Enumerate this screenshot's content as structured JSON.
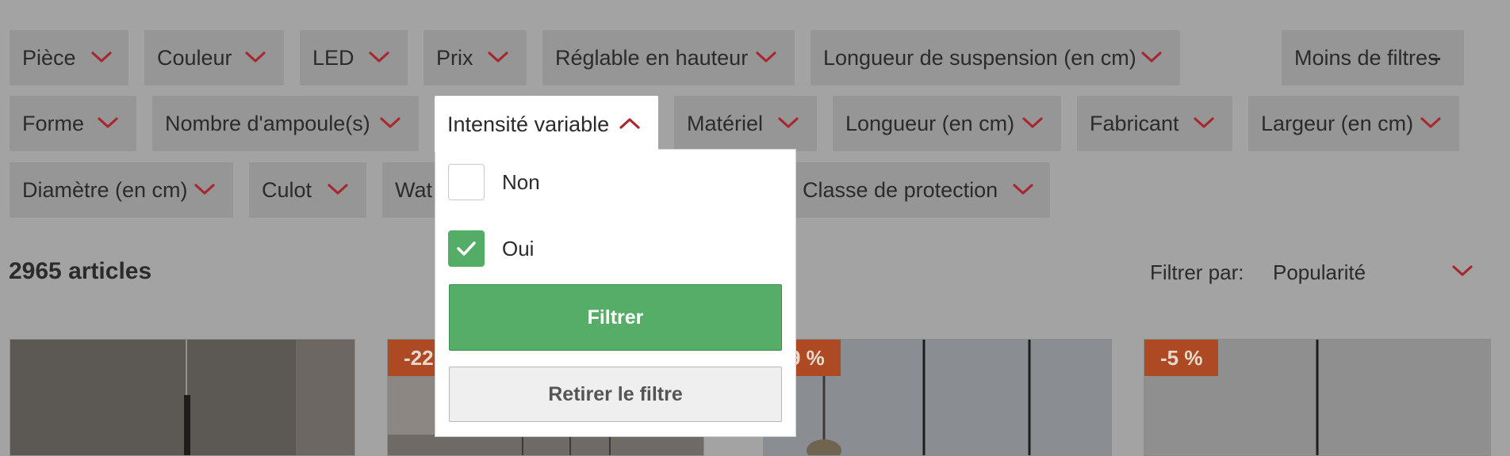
{
  "filters": {
    "row1": [
      {
        "label": "Pièce"
      },
      {
        "label": "Couleur"
      },
      {
        "label": "LED"
      },
      {
        "label": "Prix"
      },
      {
        "label": "Réglable en hauteur"
      },
      {
        "label": "Longueur de suspension (en cm)"
      }
    ],
    "less_filters": "Moins de filtres",
    "row2": [
      {
        "label": "Forme"
      },
      {
        "label": "Nombre d'ampoule(s)"
      },
      {
        "label": "Intensité variable"
      },
      {
        "label": "Matériel"
      },
      {
        "label": "Longueur (en cm)"
      },
      {
        "label": "Fabricant"
      },
      {
        "label": "Largeur (en cm)"
      }
    ],
    "row3": [
      {
        "label": "Diamètre (en cm)"
      },
      {
        "label": "Culot"
      },
      {
        "label": "Wat"
      },
      {
        "label": "Classe de protection"
      }
    ]
  },
  "dropdown": {
    "options": [
      {
        "label": "Non",
        "checked": false
      },
      {
        "label": "Oui",
        "checked": true
      }
    ],
    "apply_label": "Filtrer",
    "remove_label": "Retirer le filtre"
  },
  "results": {
    "count": "2965 articles",
    "sort_label": "Filtrer par:",
    "sort_value": "Popularité"
  },
  "products": [
    {
      "badge": ""
    },
    {
      "badge": "-22"
    },
    {
      "badge": "9 %"
    },
    {
      "badge": "-5 %"
    }
  ],
  "colors": {
    "accent": "#a7282f",
    "green": "#54ad67",
    "badge": "#ad4a23"
  }
}
